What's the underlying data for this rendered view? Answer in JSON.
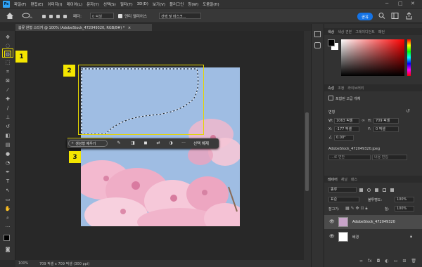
{
  "menubar": {
    "logo": "Ps",
    "items": [
      "파일(F)",
      "편집(E)",
      "이미지(I)",
      "레이어(L)",
      "문자(Y)",
      "선택(S)",
      "필터(T)",
      "3D(D)",
      "보기(V)",
      "플러그인",
      "창(W)",
      "도움말(H)"
    ],
    "minimize": "─",
    "maximize": "□",
    "close": "✕"
  },
  "options": {
    "feather_label": "페더:",
    "feather_value": "0 픽셀",
    "antialias_label": "앤티 앨리어스",
    "select_mask": "선택 및 마스크...",
    "share": "공유"
  },
  "document": {
    "tab_title": "봄꽃 원형 스티커 @ 100% (AdobeStock_472049320, RGB/8#) *",
    "tab_close": "×"
  },
  "callouts": [
    "1",
    "2",
    "3"
  ],
  "taskbar": {
    "generative_fill": "생성형 채우기",
    "deselect": "선택 해제",
    "more": "···"
  },
  "status": {
    "zoom": "100%",
    "info": "709 픽셀 x 709 픽셀 (300 ppi)"
  },
  "color_panel": {
    "tabs": [
      "색상",
      "색상 견본",
      "그레이디언트",
      "패턴"
    ]
  },
  "properties_panel": {
    "tabs": [
      "속성",
      "조정",
      "라이브러리"
    ],
    "layer_type": "포함된 고급 개체",
    "transform_label": "변형",
    "w_label": "W:",
    "w_value": "1063 픽셀",
    "h_label": "H:",
    "h_value": "709 픽셀",
    "x_label": "X:",
    "x_value": "-177 픽셀",
    "y_label": "Y:",
    "y_value": "0 픽셀",
    "angle_value": "0.00°",
    "filename": "AdobeStock_472049320.jpeg",
    "embed_note": "...로 변환",
    "edit_note": "내용 편집"
  },
  "layers_panel": {
    "tabs": [
      "레이어",
      "채널",
      "패스"
    ],
    "kind": "종류",
    "blend_mode": "표준",
    "opacity_label": "불투명도:",
    "opacity_value": "100%",
    "lock_label": "잠그기:",
    "fill_label": "칠:",
    "fill_value": "100%",
    "layers": [
      {
        "name": "AdobeStock_472049320",
        "selected": true
      },
      {
        "name": "배경",
        "selected": false
      }
    ]
  },
  "colors": {
    "accent_yellow": "#f4e600",
    "share_blue": "#1473e6",
    "sky": "#9ebbe0",
    "blossom": "#f3b9cf"
  }
}
